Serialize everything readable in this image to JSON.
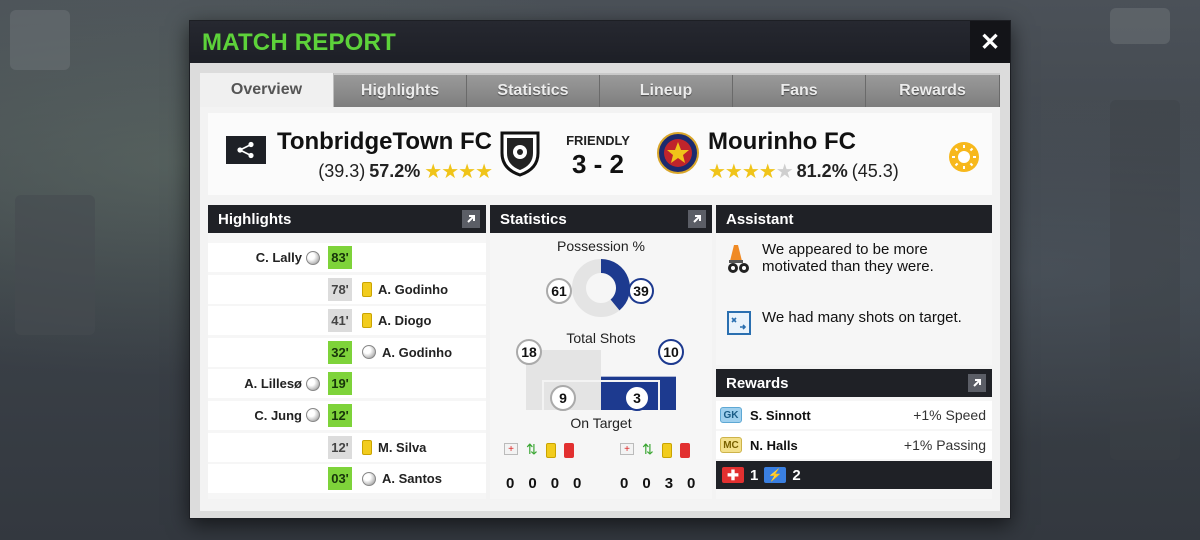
{
  "modal": {
    "title": "MATCH REPORT",
    "close_label": "✕"
  },
  "tabs": [
    {
      "label": "Overview",
      "active": true
    },
    {
      "label": "Highlights",
      "active": false
    },
    {
      "label": "Statistics",
      "active": false
    },
    {
      "label": "Lineup",
      "active": false
    },
    {
      "label": "Fans",
      "active": false
    },
    {
      "label": "Rewards",
      "active": false
    }
  ],
  "match": {
    "type": "FRIENDLY",
    "score": "3 - 2",
    "home": {
      "name": "TonbridgeTown FC",
      "rating_paren": "(39.3)",
      "percent": "57.2%",
      "stars": "★★★★"
    },
    "away": {
      "name": "Mourinho FC",
      "stars": "★★★★",
      "half_star": "★",
      "percent": "81.2%",
      "rating_paren": "(45.3)"
    },
    "weather_icon": "sun-icon"
  },
  "highlights": {
    "title": "Highlights",
    "rows": [
      {
        "side": "home",
        "player": "C. Lally",
        "minute": "83'",
        "event": "goal",
        "minute_color": "green"
      },
      {
        "side": "away",
        "player": "A. Godinho",
        "minute": "78'",
        "event": "yellow",
        "minute_color": "gray"
      },
      {
        "side": "away",
        "player": "A. Diogo",
        "minute": "41'",
        "event": "yellow",
        "minute_color": "gray"
      },
      {
        "side": "away",
        "player": "A. Godinho",
        "minute": "32'",
        "event": "goal",
        "minute_color": "green"
      },
      {
        "side": "home",
        "player": "A. Lillesø",
        "minute": "19'",
        "event": "goal",
        "minute_color": "green"
      },
      {
        "side": "home",
        "player": "C. Jung",
        "minute": "12'",
        "event": "goal",
        "minute_color": "green"
      },
      {
        "side": "away",
        "player": "M. Silva",
        "minute": "12'",
        "event": "yellow",
        "minute_color": "gray"
      },
      {
        "side": "away",
        "player": "A. Santos",
        "minute": "03'",
        "event": "goal",
        "minute_color": "green"
      }
    ]
  },
  "statistics": {
    "title": "Statistics",
    "possession_label": "Possession %",
    "possession_home": 61,
    "possession_away": 39,
    "total_shots_label": "Total Shots",
    "shots_home": 18,
    "shots_away": 10,
    "on_target_label": "On Target",
    "on_target_home": 9,
    "on_target_away": 3,
    "home_cards": [
      "0",
      "0",
      "0",
      "0"
    ],
    "away_cards": [
      "0",
      "0",
      "3",
      "0"
    ],
    "colors": {
      "home": "#e4e4e4",
      "away": "#1d3a8f"
    }
  },
  "assistant": {
    "title": "Assistant",
    "items": [
      {
        "icon": "cones-icon",
        "text": "We appeared to be more motivated than they were."
      },
      {
        "icon": "tactics-board-icon",
        "text": "We had many shots on target."
      }
    ]
  },
  "rewards": {
    "title": "Rewards",
    "rows": [
      {
        "position": "GK",
        "player": "S. Sinnott",
        "value": "+1% Speed"
      },
      {
        "position": "MC",
        "player": "N. Halls",
        "value": "+1% Passing"
      }
    ],
    "medkits": "1",
    "boosts": "2"
  }
}
